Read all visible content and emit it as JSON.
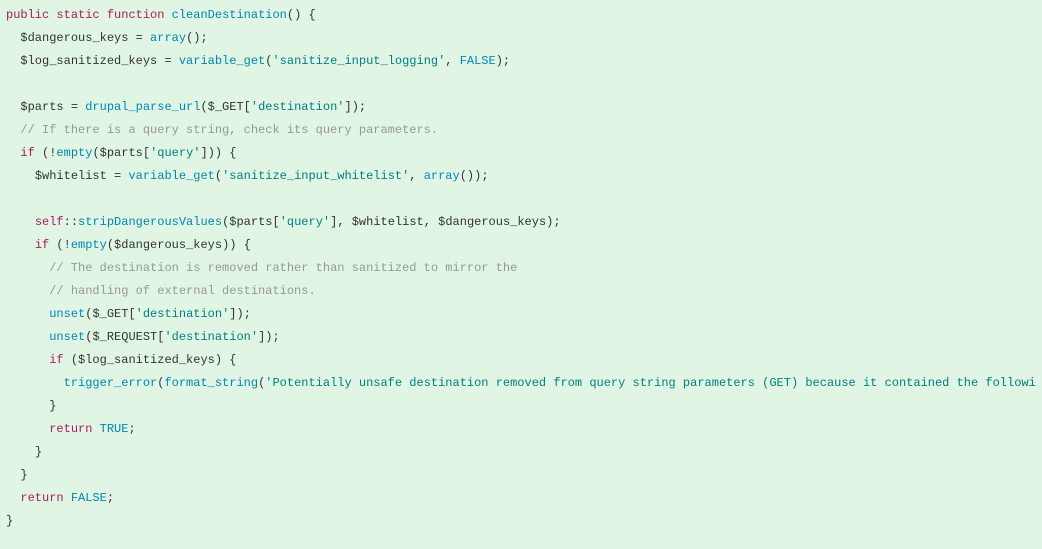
{
  "tokens": {
    "public": "public",
    "static": "static",
    "function": "function",
    "fnName": "cleanDestination",
    "array": "array",
    "variable_get": "variable_get",
    "drupal_parse_url": "drupal_parse_url",
    "empty": "empty",
    "self": "self",
    "stripDangerousValues": "stripDangerousValues",
    "unset": "unset",
    "trigger_error": "trigger_error",
    "format_string": "format_string",
    "if": "if",
    "return": "return",
    "TRUE": "TRUE",
    "FALSE": "FALSE"
  },
  "vars": {
    "dangerous_keys": "$dangerous_keys",
    "log_sanitized_keys": "$log_sanitized_keys",
    "parts": "$parts",
    "GET": "$_GET",
    "REQUEST": "$_REQUEST",
    "whitelist": "$whitelist"
  },
  "strings": {
    "sanitize_input_logging": "'sanitize_input_logging'",
    "destination": "'destination'",
    "query": "'query'",
    "sanitize_input_whitelist": "'sanitize_input_whitelist'",
    "long_msg": "'Potentially unsafe destination removed from query string parameters (GET) because it contained the followi"
  },
  "comments": {
    "c1": "// If there is a query string, check its query parameters.",
    "c2": "// The destination is removed rather than sanitized to mirror the",
    "c3": "// handling of external destinations."
  },
  "punct": {
    "op_par": "(",
    "cl_par": ")",
    "op_brace": "{",
    "cl_brace": "}",
    "op_brack": "[",
    "cl_brack": "]",
    "semi": ";",
    "comma": ",",
    "eq": "=",
    "bang": "!",
    "dcolon": "::"
  },
  "indent": {
    "i0": "",
    "i1": "  ",
    "i2": "    ",
    "i3": "      ",
    "i4": "        "
  }
}
